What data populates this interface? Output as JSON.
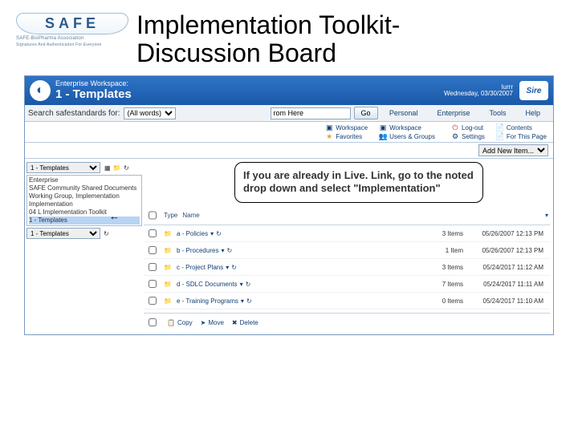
{
  "slide": {
    "title": "Implementation Toolkit-\nDiscussion Board",
    "logo_text": "SAFE",
    "logo_sub": "SAFE-BioPharma Association",
    "logo_tag": "Signatures And Authentication For Everyone"
  },
  "banner": {
    "workspace_label": "Enterprise Workspace:",
    "page_title": "1 - Templates",
    "user": "lurrr",
    "date": "Wednesday, 03/30/2007",
    "product": "Sire"
  },
  "search": {
    "label": "Search safestandards for:",
    "scope_selected": "(All words)",
    "from_label": "rom Here",
    "go_label": "Go"
  },
  "top_menu": [
    "Personal",
    "Enterprise",
    "Tools",
    "Help"
  ],
  "quicklinks": {
    "left": [
      {
        "icon": "🗔",
        "label": "Workspace"
      },
      {
        "icon": "★",
        "label": "Favorites"
      }
    ],
    "mid": [
      {
        "icon": "🗔",
        "label": "Workspace"
      },
      {
        "icon": "👥",
        "label": "Users & Groups"
      }
    ],
    "right": [
      {
        "icon": "↩",
        "label": "Log-out"
      },
      {
        "icon": "⚙",
        "label": "Settings"
      }
    ],
    "far": [
      {
        "icon": "📄",
        "label": "Contents"
      },
      {
        "icon": "📄",
        "label": "For This Page"
      }
    ]
  },
  "add_item": {
    "label": "Add New Item..."
  },
  "sidebar": {
    "dropdown_top": "1 - Templates",
    "tree": [
      "Enterprise",
      "SAFE Community Shared Documents",
      "Working Group, Implementation",
      "Implementation",
      "04  L Implementation Toolkit",
      "1 - Templates"
    ],
    "highlight_index": 5,
    "dropdown_bottom": "1 - Templates"
  },
  "list": {
    "head_type": "Type",
    "head_name": "Name",
    "rows": [
      {
        "name": "a - Policies",
        "size": "3 Items",
        "date": "05/26/2007 12:13 PM"
      },
      {
        "name": "b - Procedures",
        "size": "1 Item",
        "date": "05/26/2007 12:13 PM"
      },
      {
        "name": "c - Project Plans",
        "size": "3 Items",
        "date": "05/24/2017 11:12 AM"
      },
      {
        "name": "d - SDLC Documents",
        "size": "7 Items",
        "date": "05/24/2017 11:11 AM"
      },
      {
        "name": "e - Training Programs",
        "size": "0 Items",
        "date": "05/24/2017 11:10 AM"
      }
    ]
  },
  "actions": {
    "copy": "Copy",
    "move": "Move",
    "delete": "Delete"
  },
  "callout": "If you are already in Live. Link, go to the noted drop down and select \"Implementation\""
}
